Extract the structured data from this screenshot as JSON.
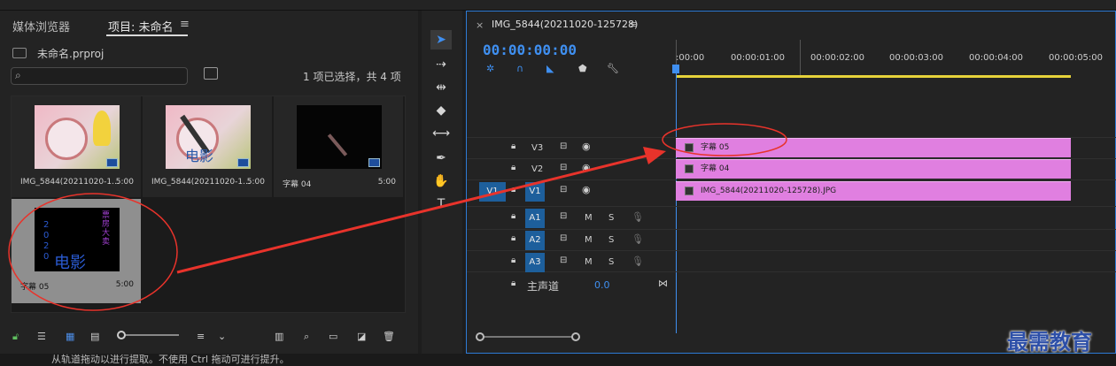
{
  "project": {
    "tabs": [
      "媒体浏览器",
      "项目: 未命名"
    ],
    "file_name": "未命名.prproj",
    "selection_info": "1 项已选择，共 4 项",
    "items": [
      {
        "name": "IMG_5844(20211020-1...",
        "duration": "5:00"
      },
      {
        "name": "IMG_5844(20211020-1...",
        "duration": "5:00"
      },
      {
        "name": "字幕 04",
        "duration": "5:00"
      },
      {
        "name": "字幕 05",
        "duration": "5:00"
      }
    ],
    "thumb_text": {
      "card2_overlay": "电影",
      "card4_vertical": "2020",
      "card4_right": "票房大卖",
      "card4_bottom": "电影"
    }
  },
  "timeline": {
    "sequence_name": "IMG_5844(20211020-125728)",
    "timecode": "00:00:00:00",
    "ruler": [
      ":00:00",
      "00:00:01:00",
      "00:00:02:00",
      "00:00:03:00",
      "00:00:04:00",
      "00:00:05:00"
    ],
    "tracks": [
      {
        "label": "V3",
        "clip": "字幕 05"
      },
      {
        "label": "V2",
        "clip": "字幕 04"
      },
      {
        "label": "V1",
        "clip": "IMG_5844(20211020-125728).JPG",
        "src": "V1"
      }
    ],
    "audio_tracks": [
      {
        "label": "A1",
        "m": "M",
        "s": "S"
      },
      {
        "label": "A2",
        "m": "M",
        "s": "S"
      },
      {
        "label": "A3",
        "m": "M",
        "s": "S"
      }
    ],
    "master": {
      "label": "主声道",
      "value": "0.0"
    }
  },
  "status": "从轨道拖动以进行提取。不使用 Ctrl 拖动可进行提升。",
  "watermark": "最需教育",
  "colors": {
    "accent": "#2e7bd6",
    "clip": "#e07fe0",
    "arrow": "#e8332b",
    "annotation": "#e8332b",
    "track_selected": "#1d5f9c"
  }
}
